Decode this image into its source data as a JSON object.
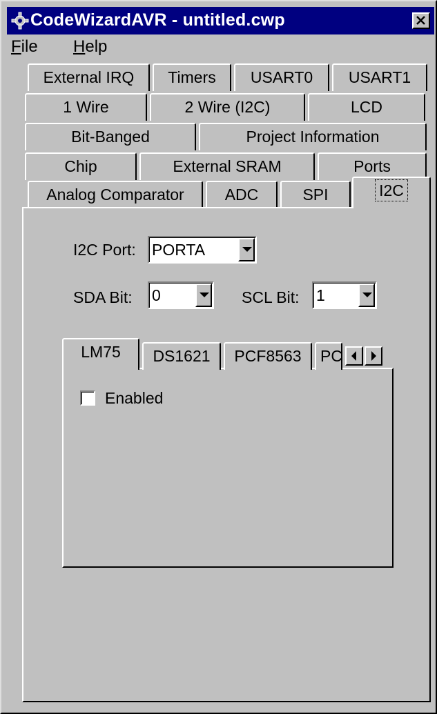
{
  "window": {
    "title": "CodeWizardAVR - untitled.cwp",
    "app_icon": "gear-icon",
    "close_icon": "close-icon"
  },
  "menu": {
    "file": {
      "accel": "F",
      "rest": "ile"
    },
    "help": {
      "accel": "H",
      "rest": "elp"
    }
  },
  "main_tabs": {
    "row1": [
      "External IRQ",
      "Timers",
      "USART0",
      "USART1"
    ],
    "row2": [
      "1 Wire",
      "2 Wire (I2C)",
      "LCD"
    ],
    "row3": [
      "Bit-Banged",
      "Project Information"
    ],
    "row4": [
      "Chip",
      "External SRAM",
      "Ports"
    ],
    "row5": [
      "Analog Comparator",
      "ADC",
      "SPI",
      "I2C"
    ],
    "active": "I2C"
  },
  "i2c": {
    "port_label": "I2C Port:",
    "port_value": "PORTA",
    "sda_label": "SDA Bit:",
    "sda_value": "0",
    "scl_label": "SCL Bit:",
    "scl_value": "1"
  },
  "device_tabs": {
    "items": [
      "LM75",
      "DS1621",
      "PCF8563",
      "PC"
    ],
    "active": "LM75"
  },
  "lm75": {
    "enabled_label": "Enabled",
    "enabled_checked": false
  }
}
